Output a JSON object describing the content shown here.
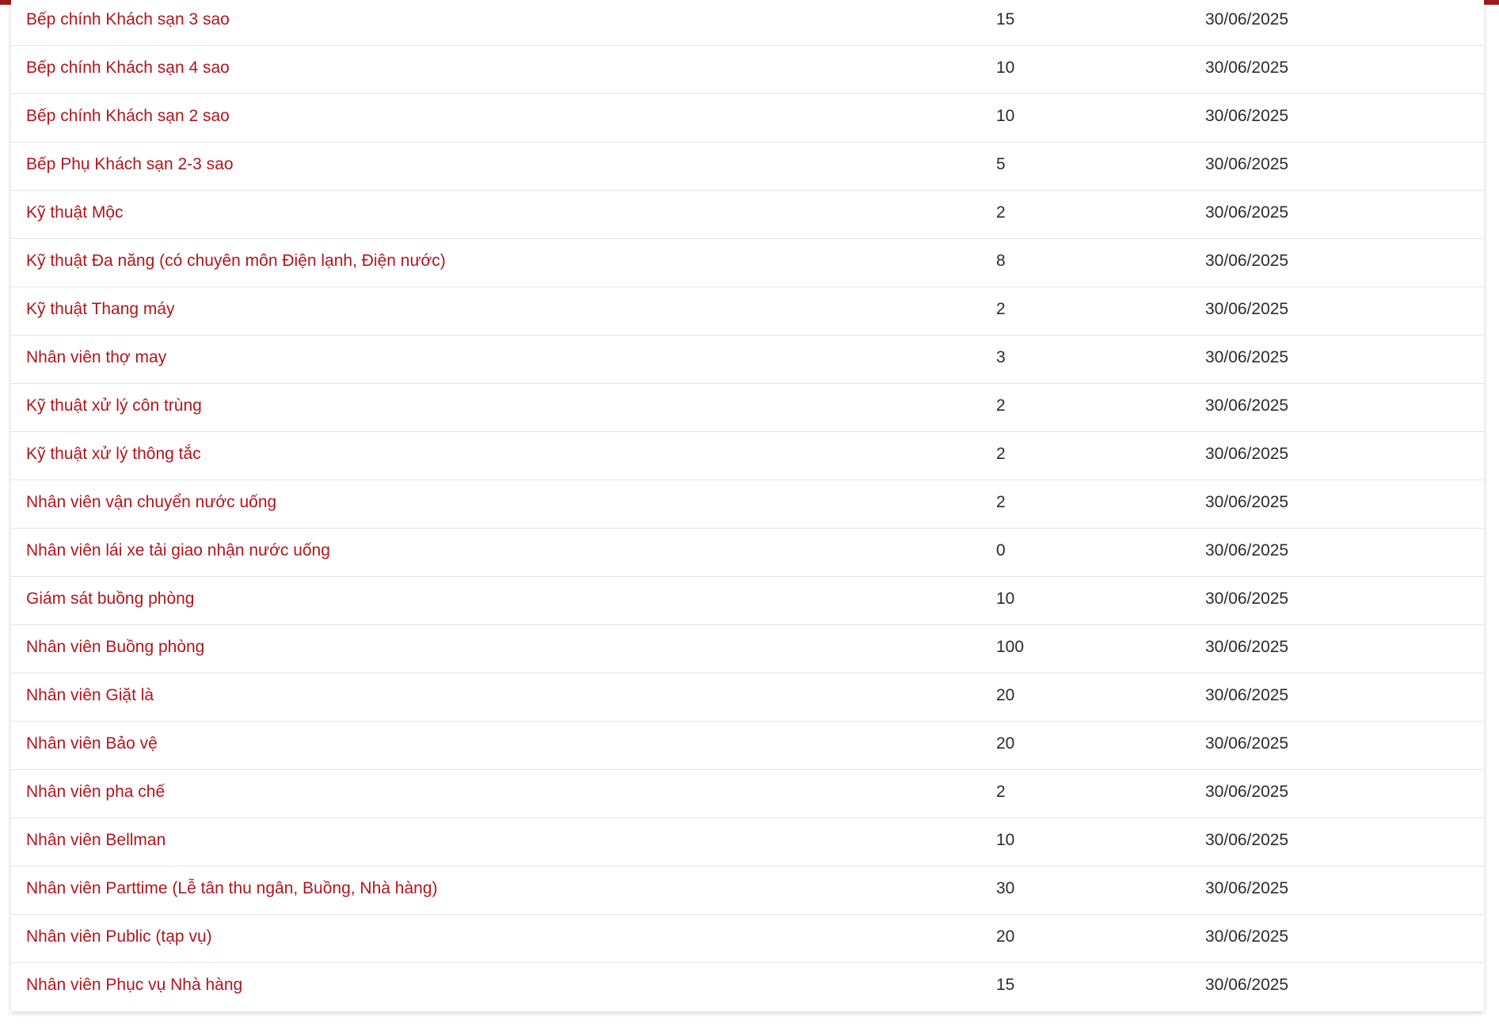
{
  "colors": {
    "accent": "#9b1c1f",
    "link": "#b0161d",
    "text": "#2b2b2b",
    "divider": "#e3e3e3"
  },
  "rows": [
    {
      "title": "Bếp chính Khách sạn 3 sao",
      "quantity": "15",
      "deadline": "30/06/2025"
    },
    {
      "title": "Bếp chính Khách sạn 4 sao",
      "quantity": "10",
      "deadline": "30/06/2025"
    },
    {
      "title": "Bếp chính Khách sạn 2 sao",
      "quantity": "10",
      "deadline": "30/06/2025"
    },
    {
      "title": "Bếp Phụ Khách sạn 2-3 sao",
      "quantity": "5",
      "deadline": "30/06/2025"
    },
    {
      "title": "Kỹ thuật Mộc",
      "quantity": "2",
      "deadline": "30/06/2025"
    },
    {
      "title": "Kỹ thuật Đa năng (có chuyên môn Điện lạnh, Điện nước)",
      "quantity": "8",
      "deadline": "30/06/2025"
    },
    {
      "title": "Kỹ thuật Thang máy",
      "quantity": "2",
      "deadline": "30/06/2025"
    },
    {
      "title": "Nhân viên thợ may",
      "quantity": "3",
      "deadline": "30/06/2025"
    },
    {
      "title": "Kỹ thuật xử lý côn trùng",
      "quantity": "2",
      "deadline": "30/06/2025"
    },
    {
      "title": "Kỹ thuật xử lý thông tắc",
      "quantity": "2",
      "deadline": "30/06/2025"
    },
    {
      "title": "Nhân viên vận chuyển nước uống",
      "quantity": "2",
      "deadline": "30/06/2025"
    },
    {
      "title": "Nhân viên lái xe tải giao nhận nước uống",
      "quantity": "0",
      "deadline": "30/06/2025"
    },
    {
      "title": "Giám sát buồng phòng",
      "quantity": "10",
      "deadline": "30/06/2025"
    },
    {
      "title": "Nhân viên Buồng phòng",
      "quantity": "100",
      "deadline": "30/06/2025"
    },
    {
      "title": "Nhân viên Giặt là",
      "quantity": "20",
      "deadline": "30/06/2025"
    },
    {
      "title": "Nhân viên Bảo vệ",
      "quantity": "20",
      "deadline": "30/06/2025"
    },
    {
      "title": "Nhân viên pha chế",
      "quantity": "2",
      "deadline": "30/06/2025"
    },
    {
      "title": "Nhân viên Bellman",
      "quantity": "10",
      "deadline": "30/06/2025"
    },
    {
      "title": "Nhân viên Parttime (Lễ tân thu ngân, Buồng, Nhà hàng)",
      "quantity": "30",
      "deadline": "30/06/2025"
    },
    {
      "title": "Nhân viên Public (tạp vụ)",
      "quantity": "20",
      "deadline": "30/06/2025"
    },
    {
      "title": "Nhân viên Phục vụ Nhà hàng",
      "quantity": "15",
      "deadline": "30/06/2025"
    }
  ]
}
